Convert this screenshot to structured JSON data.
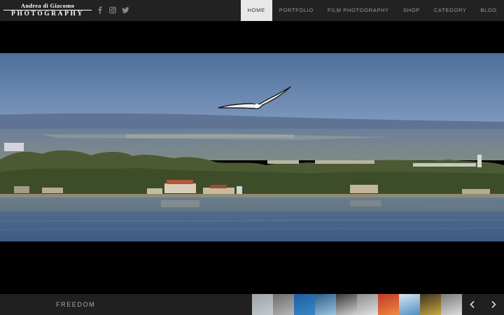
{
  "site": {
    "logo_line1": "Andrea di Giacomo",
    "logo_line2": "PHOTOGRAPHY"
  },
  "social": [
    "facebook-icon",
    "instagram-icon",
    "twitter-icon"
  ],
  "nav": {
    "items": [
      {
        "label": "HOME",
        "active": true
      },
      {
        "label": "PORTFOLIO",
        "active": false
      },
      {
        "label": "FILM PHOTOGRAPHY",
        "active": false
      },
      {
        "label": "SHOP",
        "active": false
      },
      {
        "label": "CATEGORY",
        "active": false
      },
      {
        "label": "BLOG",
        "active": false
      }
    ]
  },
  "slide": {
    "caption": "FREEDOM"
  },
  "thumbnails": [
    {
      "colors": [
        "#9aa3a8",
        "#c4c9cc"
      ]
    },
    {
      "colors": [
        "#6b6b6b",
        "#b5b5b5"
      ]
    },
    {
      "colors": [
        "#1f5f9e",
        "#3a86c8"
      ]
    },
    {
      "colors": [
        "#2d5f8a",
        "#9cc3de"
      ]
    },
    {
      "colors": [
        "#3a3a3a",
        "#d0d0d0"
      ]
    },
    {
      "colors": [
        "#8c8c8c",
        "#e2e2e2"
      ]
    },
    {
      "colors": [
        "#c0392b",
        "#f08a3c"
      ]
    },
    {
      "colors": [
        "#d9e6ee",
        "#4d8fc2"
      ]
    },
    {
      "colors": [
        "#3b3520",
        "#c9a640"
      ]
    },
    {
      "colors": [
        "#7b7b7b",
        "#dcdcdc"
      ]
    }
  ],
  "controls": {
    "prev": "chevron-left-icon",
    "next": "chevron-right-icon"
  },
  "colors": {
    "topbar": "#222222",
    "active_nav_bg": "#e8e8e8",
    "bottombar": "#202020"
  }
}
